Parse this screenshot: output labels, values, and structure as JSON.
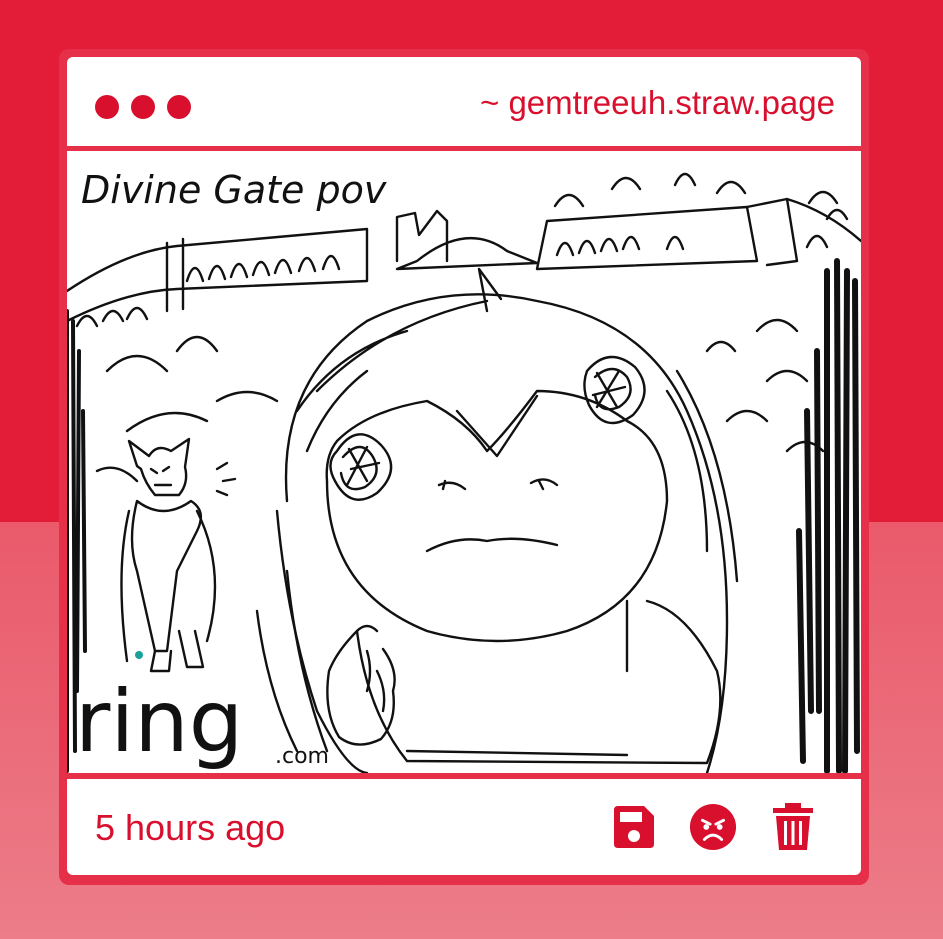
{
  "window": {
    "url": "~ gemtreeuh.straw.page"
  },
  "drawing": {
    "caption": "Divine Gate pov",
    "watermark_main": "ring",
    "watermark_suffix": ".com"
  },
  "footer": {
    "timestamp": "5 hours ago",
    "actions": [
      {
        "icon": "save-icon"
      },
      {
        "icon": "angry-face-icon"
      },
      {
        "icon": "trash-icon"
      }
    ]
  },
  "colors": {
    "accent": "#d90f2e",
    "background": "#e31d37",
    "card_border": "#e63049"
  }
}
